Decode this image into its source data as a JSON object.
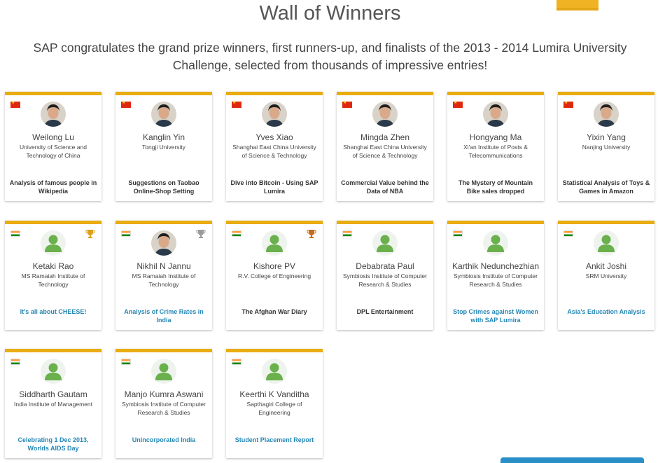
{
  "page": {
    "title": "Wall of Winners",
    "subtitle": "SAP congratulates the grand prize winners, first runners-up, and finalists of the 2013 - 2014 Lumira University Challenge, selected from thousands of impressive entries!"
  },
  "colors": {
    "accent": "#e9ac11",
    "link": "#2587b5",
    "gold": "#d9a21b",
    "silver": "#9a9a9a",
    "bronze": "#c96a1c",
    "avatar_green": "#6ab04c"
  },
  "winners": [
    {
      "name": "Weilong Lu",
      "school": "University of Science and Technology of China",
      "project": "Analysis of famous people in Wikipedia",
      "flag": "china-flag-icon",
      "trophy": "",
      "photo": true,
      "link": false
    },
    {
      "name": "Kanglin Yin",
      "school": "Tongji University",
      "project": "Suggestions on Taobao Online-Shop Setting",
      "flag": "china-flag-icon",
      "trophy": "",
      "photo": true,
      "link": false
    },
    {
      "name": "Yves Xiao",
      "school": "Shanghai East China University of Science & Technology",
      "project": "Dive into Bitcoin - Using SAP Lumira",
      "flag": "china-flag-icon",
      "trophy": "",
      "photo": true,
      "link": false
    },
    {
      "name": "Mingda Zhen",
      "school": "Shanghai East China University of Science & Technology",
      "project": "Commercial Value behind the Data of NBA",
      "flag": "china-flag-icon",
      "trophy": "",
      "photo": true,
      "link": false
    },
    {
      "name": "Hongyang Ma",
      "school": "Xi'an Institute of Posts & Telecommunications",
      "project": "The Mystery of Mountain Bike sales dropped",
      "flag": "china-flag-icon",
      "trophy": "",
      "photo": true,
      "link": false
    },
    {
      "name": "Yixin Yang",
      "school": "Nanjing University",
      "project": "Statistical Analysis of Toys & Games in Amazon",
      "flag": "china-flag-icon",
      "trophy": "",
      "photo": true,
      "link": false
    },
    {
      "name": "Ketaki Rao",
      "school": "MS Ramaiah Institute of Technology",
      "project": "It's all about CHEESE!",
      "flag": "india-flag-icon",
      "trophy": "gold",
      "photo": false,
      "link": true
    },
    {
      "name": "Nikhil N Jannu",
      "school": "MS Ramaiah Institute of Technology",
      "project": "Analysis of Crime Rates in India",
      "flag": "india-flag-icon",
      "trophy": "silver",
      "photo": true,
      "link": true
    },
    {
      "name": "Kishore PV",
      "school": "R.V. College of Engineering",
      "project": "The Afghan War Diary",
      "flag": "india-flag-icon",
      "trophy": "bronze",
      "photo": false,
      "link": false
    },
    {
      "name": "Debabrata Paul",
      "school": "Symbiosis Institute of Computer Research & Studies",
      "project": "DPL Entertainment",
      "flag": "india-flag-icon",
      "trophy": "",
      "photo": false,
      "link": false
    },
    {
      "name": "Karthik Nedunchezhian",
      "school": "Symbiosis Institute of Computer Research & Studies",
      "project": "Stop Crimes against Women with SAP Lumira",
      "flag": "india-flag-icon",
      "trophy": "",
      "photo": false,
      "link": true
    },
    {
      "name": "Ankit Joshi",
      "school": "SRM University",
      "project": "Asia's Education Analysis",
      "flag": "india-flag-icon",
      "trophy": "",
      "photo": false,
      "link": true
    },
    {
      "name": "Siddharth Gautam",
      "school": "India Institute of Management",
      "project": "Celebrating 1 Dec 2013, Worlds AIDS Day",
      "flag": "india-flag-icon",
      "trophy": "",
      "photo": false,
      "link": true
    },
    {
      "name": "Manjo Kumra Aswani",
      "school": "Symbiosis Institute of Computer Research & Studies",
      "project": "Unincorporated India",
      "flag": "india-flag-icon",
      "trophy": "",
      "photo": false,
      "link": true
    },
    {
      "name": "Keerthi K Vanditha",
      "school": "Sapthagiri College of Engineering",
      "project": "Student Placement Report",
      "flag": "india-flag-icon",
      "trophy": "",
      "photo": false,
      "link": true
    }
  ]
}
